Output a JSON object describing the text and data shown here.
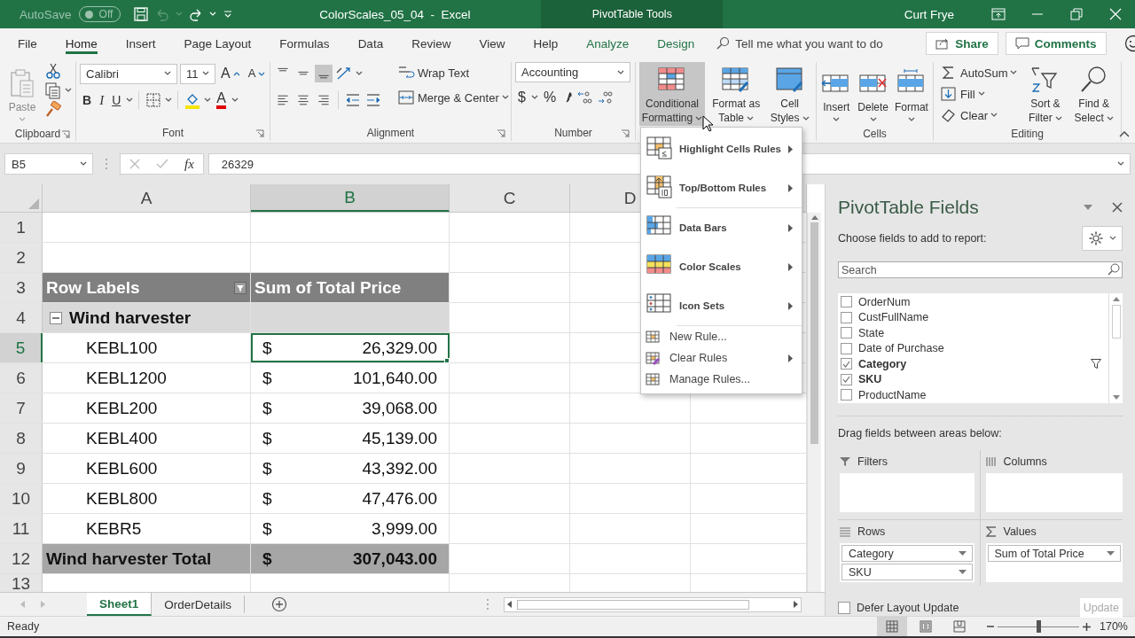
{
  "title_bar": {
    "autosave_label": "AutoSave",
    "autosave_state": "Off",
    "autosave_on": false,
    "document_title": "ColorScales_05_04  -  Excel",
    "context_label": "PivotTable Tools",
    "user": "Curt Frye"
  },
  "ribbon_tabs": [
    {
      "label": "File",
      "selected": false,
      "kind": "normal"
    },
    {
      "label": "Home",
      "selected": true,
      "kind": "normal"
    },
    {
      "label": "Insert",
      "selected": false,
      "kind": "normal"
    },
    {
      "label": "Page Layout",
      "selected": false,
      "kind": "normal"
    },
    {
      "label": "Formulas",
      "selected": false,
      "kind": "normal"
    },
    {
      "label": "Data",
      "selected": false,
      "kind": "normal"
    },
    {
      "label": "Review",
      "selected": false,
      "kind": "normal"
    },
    {
      "label": "View",
      "selected": false,
      "kind": "normal"
    },
    {
      "label": "Help",
      "selected": false,
      "kind": "normal"
    },
    {
      "label": "Analyze",
      "selected": false,
      "kind": "contextual"
    },
    {
      "label": "Design",
      "selected": false,
      "kind": "contextual"
    }
  ],
  "tell_me": {
    "placeholder": "Tell me what you want to do"
  },
  "share_button": "Share",
  "comments_button": "Comments",
  "ribbon": {
    "clipboard": {
      "label": "Clipboard",
      "paste": "Paste",
      "paste_disabled": true
    },
    "font": {
      "label": "Font",
      "font_name": "Calibri",
      "font_size": "11",
      "grow": "A",
      "shrink": "A",
      "bold": "B",
      "italic": "I",
      "underline": "U",
      "font_color": "A"
    },
    "alignment": {
      "label": "Alignment",
      "vertical_alignment": [
        {
          "kind": "top",
          "selected": false
        },
        {
          "kind": "middle",
          "selected": false
        },
        {
          "kind": "bottom",
          "selected": true
        }
      ],
      "wrap_text": "Wrap Text",
      "merge": "Merge & Center"
    },
    "number": {
      "label": "Number",
      "format": "Accounting",
      "currency": "$",
      "percent": "%"
    },
    "styles": {
      "conditional": "Conditional Formatting",
      "conditional_open": true,
      "format_table": "Format as Table",
      "cell_styles": "Cell Styles"
    },
    "cells": {
      "label": "Cells",
      "insert": "Insert",
      "delete": "Delete",
      "format": "Format"
    },
    "editing": {
      "label": "Editing",
      "autosum": "AutoSum",
      "fill": "Fill",
      "clear": "Clear",
      "sort": "Sort & Filter",
      "find": "Find & Select"
    }
  },
  "formula_bar": {
    "name_box": "B5",
    "function_label": "fx",
    "value": "26329"
  },
  "columns": [
    {
      "letter": "A",
      "selected": false
    },
    {
      "letter": "B",
      "selected": true
    },
    {
      "letter": "C",
      "selected": false
    },
    {
      "letter": "D",
      "selected": false
    }
  ],
  "rows": [
    {
      "number": "1",
      "kind": "empty",
      "selected": false
    },
    {
      "number": "2",
      "kind": "empty",
      "selected": false
    },
    {
      "number": "3",
      "kind": "header",
      "label": "Row Labels",
      "value": "Sum of Total Price",
      "selected": false
    },
    {
      "number": "4",
      "kind": "group",
      "label": "Wind harvester",
      "expanded": true,
      "selected": false
    },
    {
      "number": "5",
      "kind": "item",
      "label": "KEBL100",
      "currency": "$",
      "value": "26,329.00",
      "selected": true
    },
    {
      "number": "6",
      "kind": "item",
      "label": "KEBL1200",
      "currency": "$",
      "value": "101,640.00",
      "selected": false
    },
    {
      "number": "7",
      "kind": "item",
      "label": "KEBL200",
      "currency": "$",
      "value": "39,068.00",
      "selected": false
    },
    {
      "number": "8",
      "kind": "item",
      "label": "KEBL400",
      "currency": "$",
      "value": "45,139.00",
      "selected": false
    },
    {
      "number": "9",
      "kind": "item",
      "label": "KEBL600",
      "currency": "$",
      "value": "43,392.00",
      "selected": false
    },
    {
      "number": "10",
      "kind": "item",
      "label": "KEBL800",
      "currency": "$",
      "value": "47,476.00",
      "selected": false
    },
    {
      "number": "11",
      "kind": "item",
      "label": "KEBR5",
      "currency": "$",
      "value": "3,999.00",
      "selected": false
    },
    {
      "number": "12",
      "kind": "total",
      "label": "Wind harvester Total",
      "currency": "$",
      "value": "307,043.00",
      "selected": false
    },
    {
      "number": "13",
      "kind": "empty",
      "selected": false
    }
  ],
  "format_menu": {
    "items": [
      {
        "label": "Highlight Cells Rules",
        "kind": "large",
        "submenu": true,
        "separator_after": false
      },
      {
        "label": "Top/Bottom Rules",
        "kind": "large",
        "submenu": true,
        "separator_after": true
      },
      {
        "label": "Data Bars",
        "kind": "large",
        "submenu": true,
        "separator_after": false
      },
      {
        "label": "Color Scales",
        "kind": "large",
        "submenu": true,
        "separator_after": false
      },
      {
        "label": "Icon Sets",
        "kind": "large",
        "submenu": true,
        "separator_after": true
      },
      {
        "label": "New Rule...",
        "kind": "small",
        "submenu": false,
        "separator_after": false
      },
      {
        "label": "Clear Rules",
        "kind": "small",
        "submenu": true,
        "separator_after": false
      },
      {
        "label": "Manage Rules...",
        "kind": "small",
        "submenu": false,
        "separator_after": false
      }
    ]
  },
  "pivot_fields": {
    "title": "PivotTable Fields",
    "subtitle": "Choose fields to add to report:",
    "search": {
      "placeholder": "Search"
    },
    "fields": [
      {
        "name": "OrderNum",
        "checked": false,
        "filtered": false
      },
      {
        "name": "CustFullName",
        "checked": false,
        "filtered": false
      },
      {
        "name": "State",
        "checked": false,
        "filtered": false
      },
      {
        "name": "Date of Purchase",
        "checked": false,
        "filtered": false
      },
      {
        "name": "Category",
        "checked": true,
        "filtered": true
      },
      {
        "name": "SKU",
        "checked": true,
        "filtered": false
      },
      {
        "name": "ProductName",
        "checked": false,
        "filtered": false
      }
    ],
    "drag_hint": "Drag fields between areas below:",
    "areas": [
      {
        "kind": "filters",
        "label": "Filters"
      },
      {
        "kind": "columns",
        "label": "Columns"
      },
      {
        "kind": "rows",
        "label": "Rows",
        "items": [
          "Category",
          "SKU"
        ]
      },
      {
        "kind": "values",
        "label": "Values",
        "items": [
          "Sum of Total Price"
        ]
      }
    ],
    "defer": {
      "label": "Defer Layout Update",
      "checked": false
    },
    "update": {
      "label": "Update",
      "disabled": true
    }
  },
  "sheet_tabs": [
    {
      "label": "Sheet1",
      "selected": true
    },
    {
      "label": "OrderDetails",
      "selected": false
    }
  ],
  "status_bar": {
    "status": "Ready",
    "views": [
      {
        "kind": "normal",
        "selected": true
      },
      {
        "kind": "page_layout",
        "selected": false
      },
      {
        "kind": "page_break",
        "selected": false
      }
    ],
    "zoom_slider": {
      "level": 0.5
    },
    "zoom": "170%"
  }
}
